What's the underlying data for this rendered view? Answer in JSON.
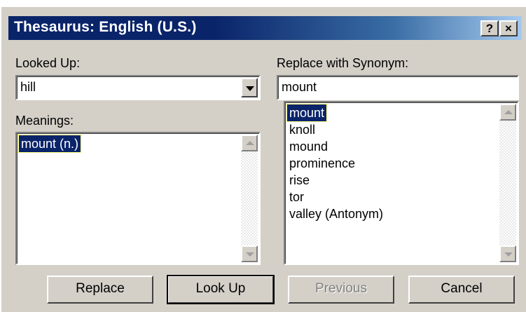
{
  "window": {
    "title": "Thesaurus: English (U.S.)",
    "help_button": "?",
    "close_button": "×"
  },
  "looked_up": {
    "label": "Looked Up:",
    "value": "hill"
  },
  "meanings": {
    "label": "Meanings:",
    "items": [
      "mount (n.)"
    ],
    "selected_index": 0
  },
  "synonym": {
    "label": "Replace with Synonym:",
    "value": "mount",
    "items": [
      "mount",
      "knoll",
      "mound",
      "prominence",
      "rise",
      "tor",
      "valley (Antonym)"
    ],
    "selected_index": 0
  },
  "buttons": {
    "replace": "Replace",
    "look_up": "Look Up",
    "previous": "Previous",
    "cancel": "Cancel"
  },
  "colors": {
    "title_active": "#0a246a",
    "face": "#d4d0c8",
    "selection": "#0a246a"
  }
}
